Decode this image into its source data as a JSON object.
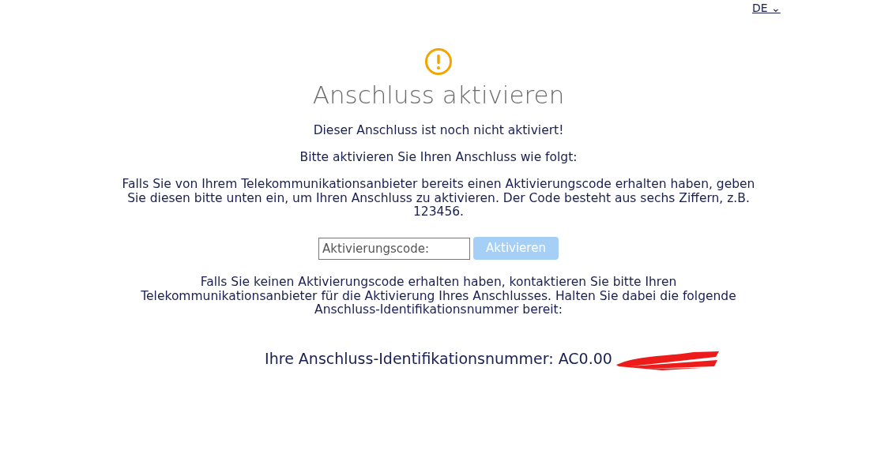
{
  "language_switcher": {
    "label": "DE",
    "caret": "⌄"
  },
  "title": "Anschluss aktivieren",
  "paragraphs": [
    "Dieser Anschluss ist noch nicht aktiviert!",
    "Bitte aktivieren Sie Ihren Anschluss wie folgt:",
    "Falls Sie von Ihrem Telekommunikationsanbieter bereits einen Aktivierungscode erhalten haben, geben Sie diesen bitte unten ein, um Ihren Anschluss zu aktivieren. Der Code besteht aus sechs Ziffern, z.B. 123456."
  ],
  "activation_form": {
    "placeholder": "Aktivierungscode:",
    "button": {
      "label": "Aktivieren",
      "disabled": true
    }
  },
  "hint": "Falls Sie keinen Aktivierungscode erhalten haben, kontaktieren Sie bitte Ihren Telekommunikationsanbieter für die Aktivierung Ihres Anschlusses. Halten Sie dabei die folgende Anschluss-Identifikationsnummer bereit:",
  "identification": {
    "text": "Ihre Anschluss-Identifikationsnummer: AC0.00",
    "redacted": true
  }
}
